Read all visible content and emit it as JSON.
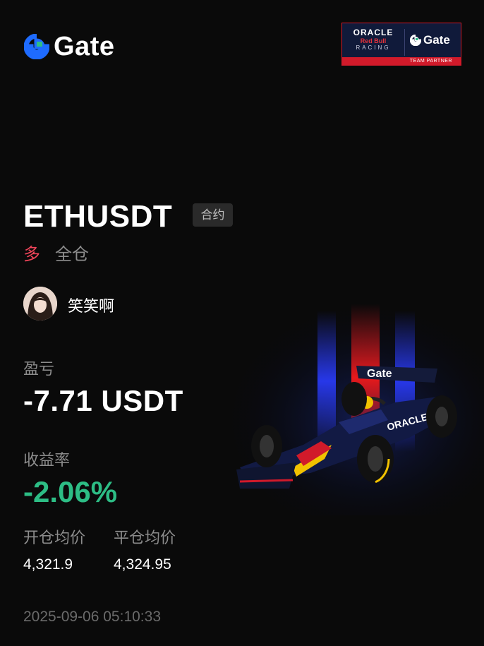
{
  "brand": {
    "name": "Gate",
    "accent": "#1E6BFF",
    "accent2": "#2DBD85"
  },
  "partner": {
    "oracle": "ORACLE",
    "redbull": "Red Bull",
    "racing": "RACING",
    "gate": "Gate",
    "bar_text": "TEAM PARTNER"
  },
  "position": {
    "pair": "ETHUSDT",
    "type_badge": "合约",
    "direction": "多",
    "margin_mode": "全仓",
    "direction_color": "#F0455A"
  },
  "user": {
    "name": "笑笑啊"
  },
  "pnl": {
    "label": "盈亏",
    "value": "-7.71 USDT"
  },
  "roi": {
    "label": "收益率",
    "value": "-2.06%",
    "color": "#2DBD85"
  },
  "prices": {
    "open_label": "开仓均价",
    "open_value": "4,321.9",
    "close_label": "平仓均价",
    "close_value": "4,324.95"
  },
  "timestamp": "2025-09-06 05:10:33"
}
